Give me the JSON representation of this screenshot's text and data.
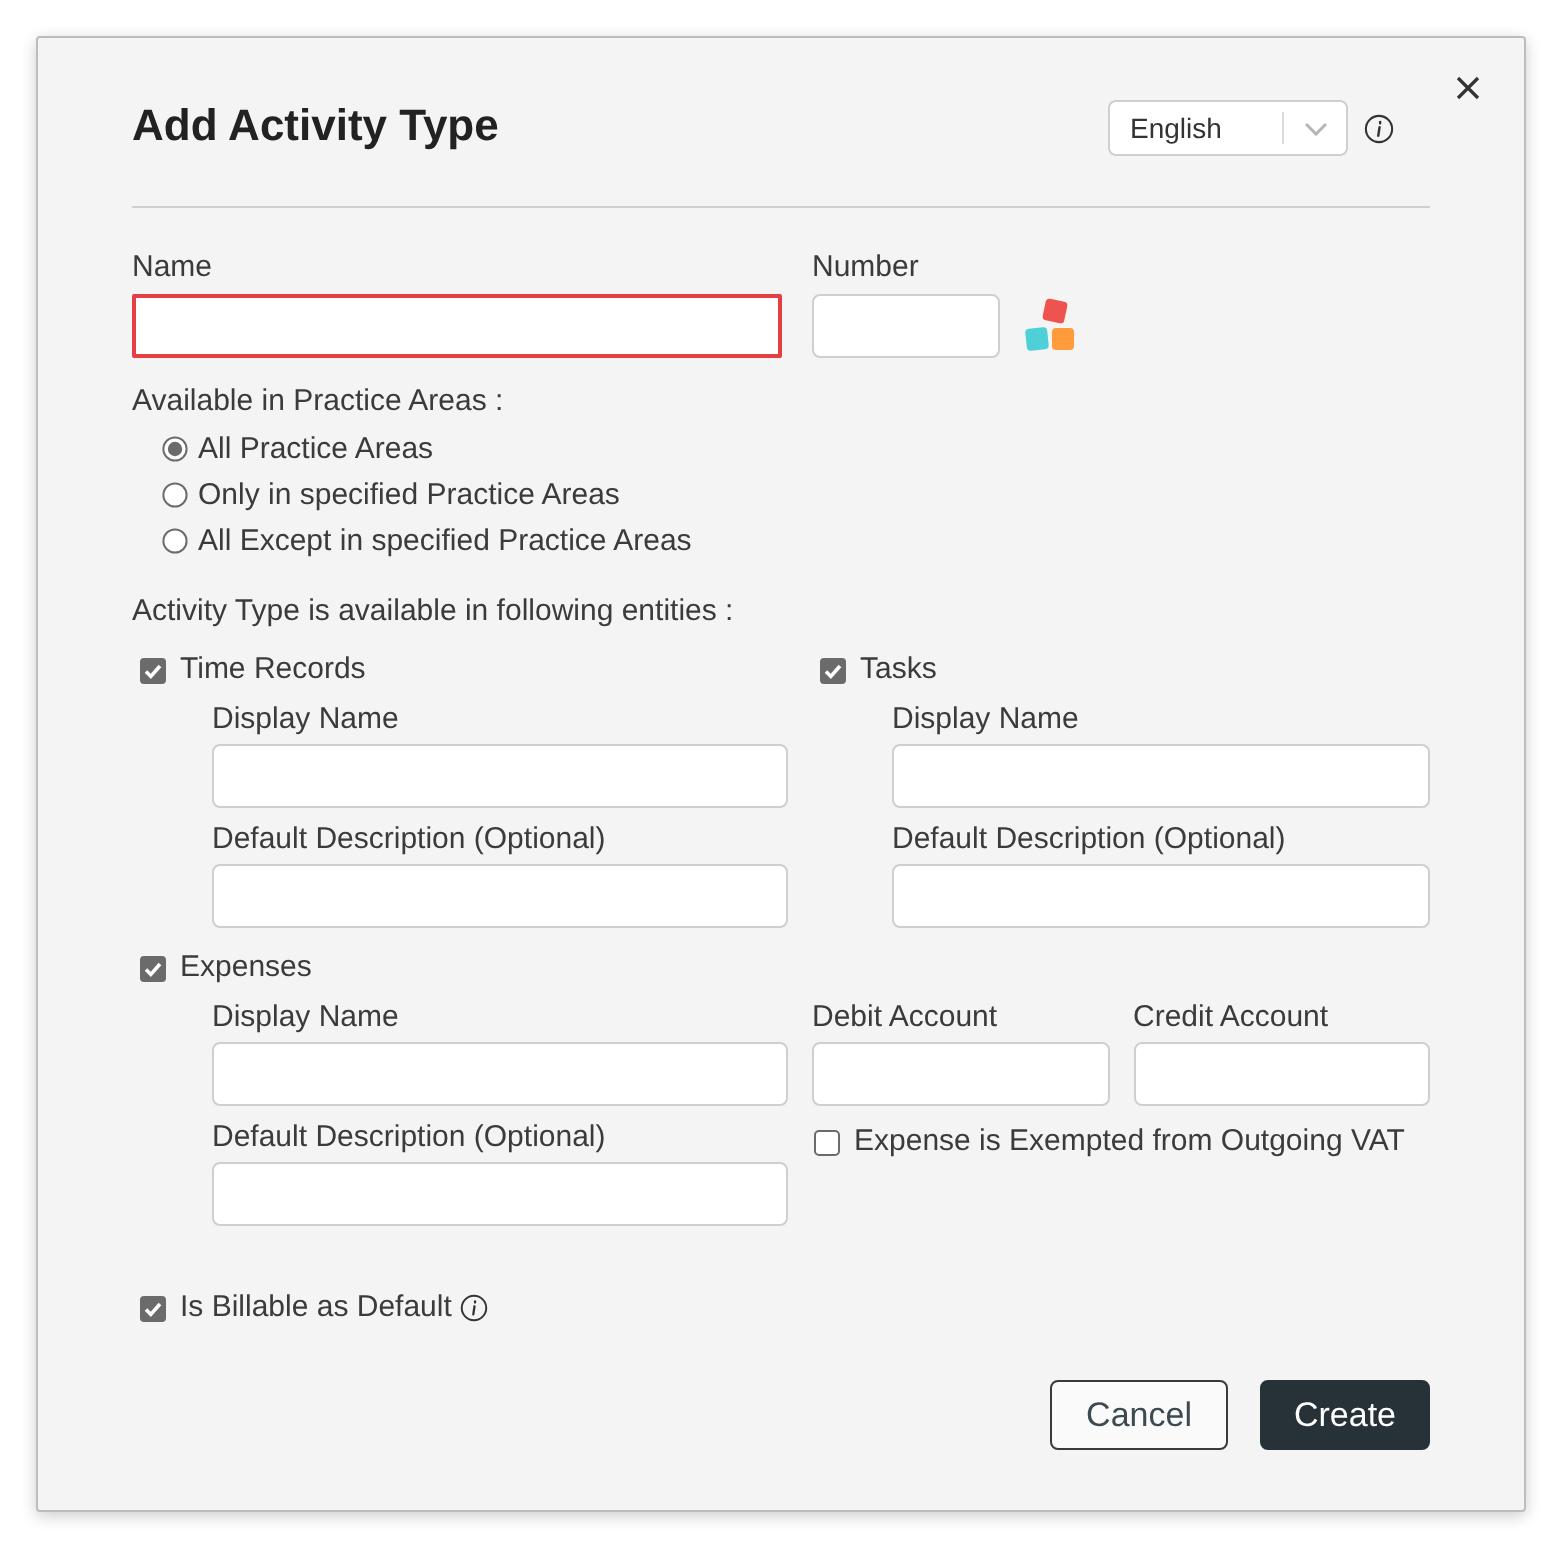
{
  "title": "Add Activity Type",
  "language_select": {
    "value": "English"
  },
  "name_field": {
    "label": "Name",
    "invalid": true
  },
  "number_field": {
    "label": "Number"
  },
  "practice_areas": {
    "label": "Available in Practice Areas :",
    "options": [
      {
        "label": "All Practice Areas",
        "selected": true
      },
      {
        "label": "Only in specified Practice Areas",
        "selected": false
      },
      {
        "label": "All Except in specified Practice Areas",
        "selected": false
      }
    ]
  },
  "entities": {
    "label": "Activity Type is available in following entities :",
    "items": [
      {
        "label": "Time Records",
        "checked": true,
        "fields": [
          {
            "label": "Display Name"
          },
          {
            "label": "Default Description (Optional)"
          }
        ]
      },
      {
        "label": "Tasks",
        "checked": true,
        "fields": [
          {
            "label": "Display Name"
          },
          {
            "label": "Default Description (Optional)"
          }
        ]
      }
    ]
  },
  "expenses": {
    "label": "Expenses",
    "checked": true,
    "fields": [
      {
        "label": "Display Name"
      },
      {
        "label": "Default Description (Optional)"
      }
    ],
    "accounts": [
      {
        "label": "Debit Account"
      },
      {
        "label": "Credit Account"
      }
    ],
    "vat_exempt": {
      "label": "Expense is Exempted from Outgoing VAT",
      "checked": false
    }
  },
  "billable": {
    "label": "Is Billable as Default",
    "checked": true
  },
  "buttons": [
    {
      "label": "Cancel",
      "kind": "secondary"
    },
    {
      "label": "Create",
      "kind": "primary"
    }
  ]
}
